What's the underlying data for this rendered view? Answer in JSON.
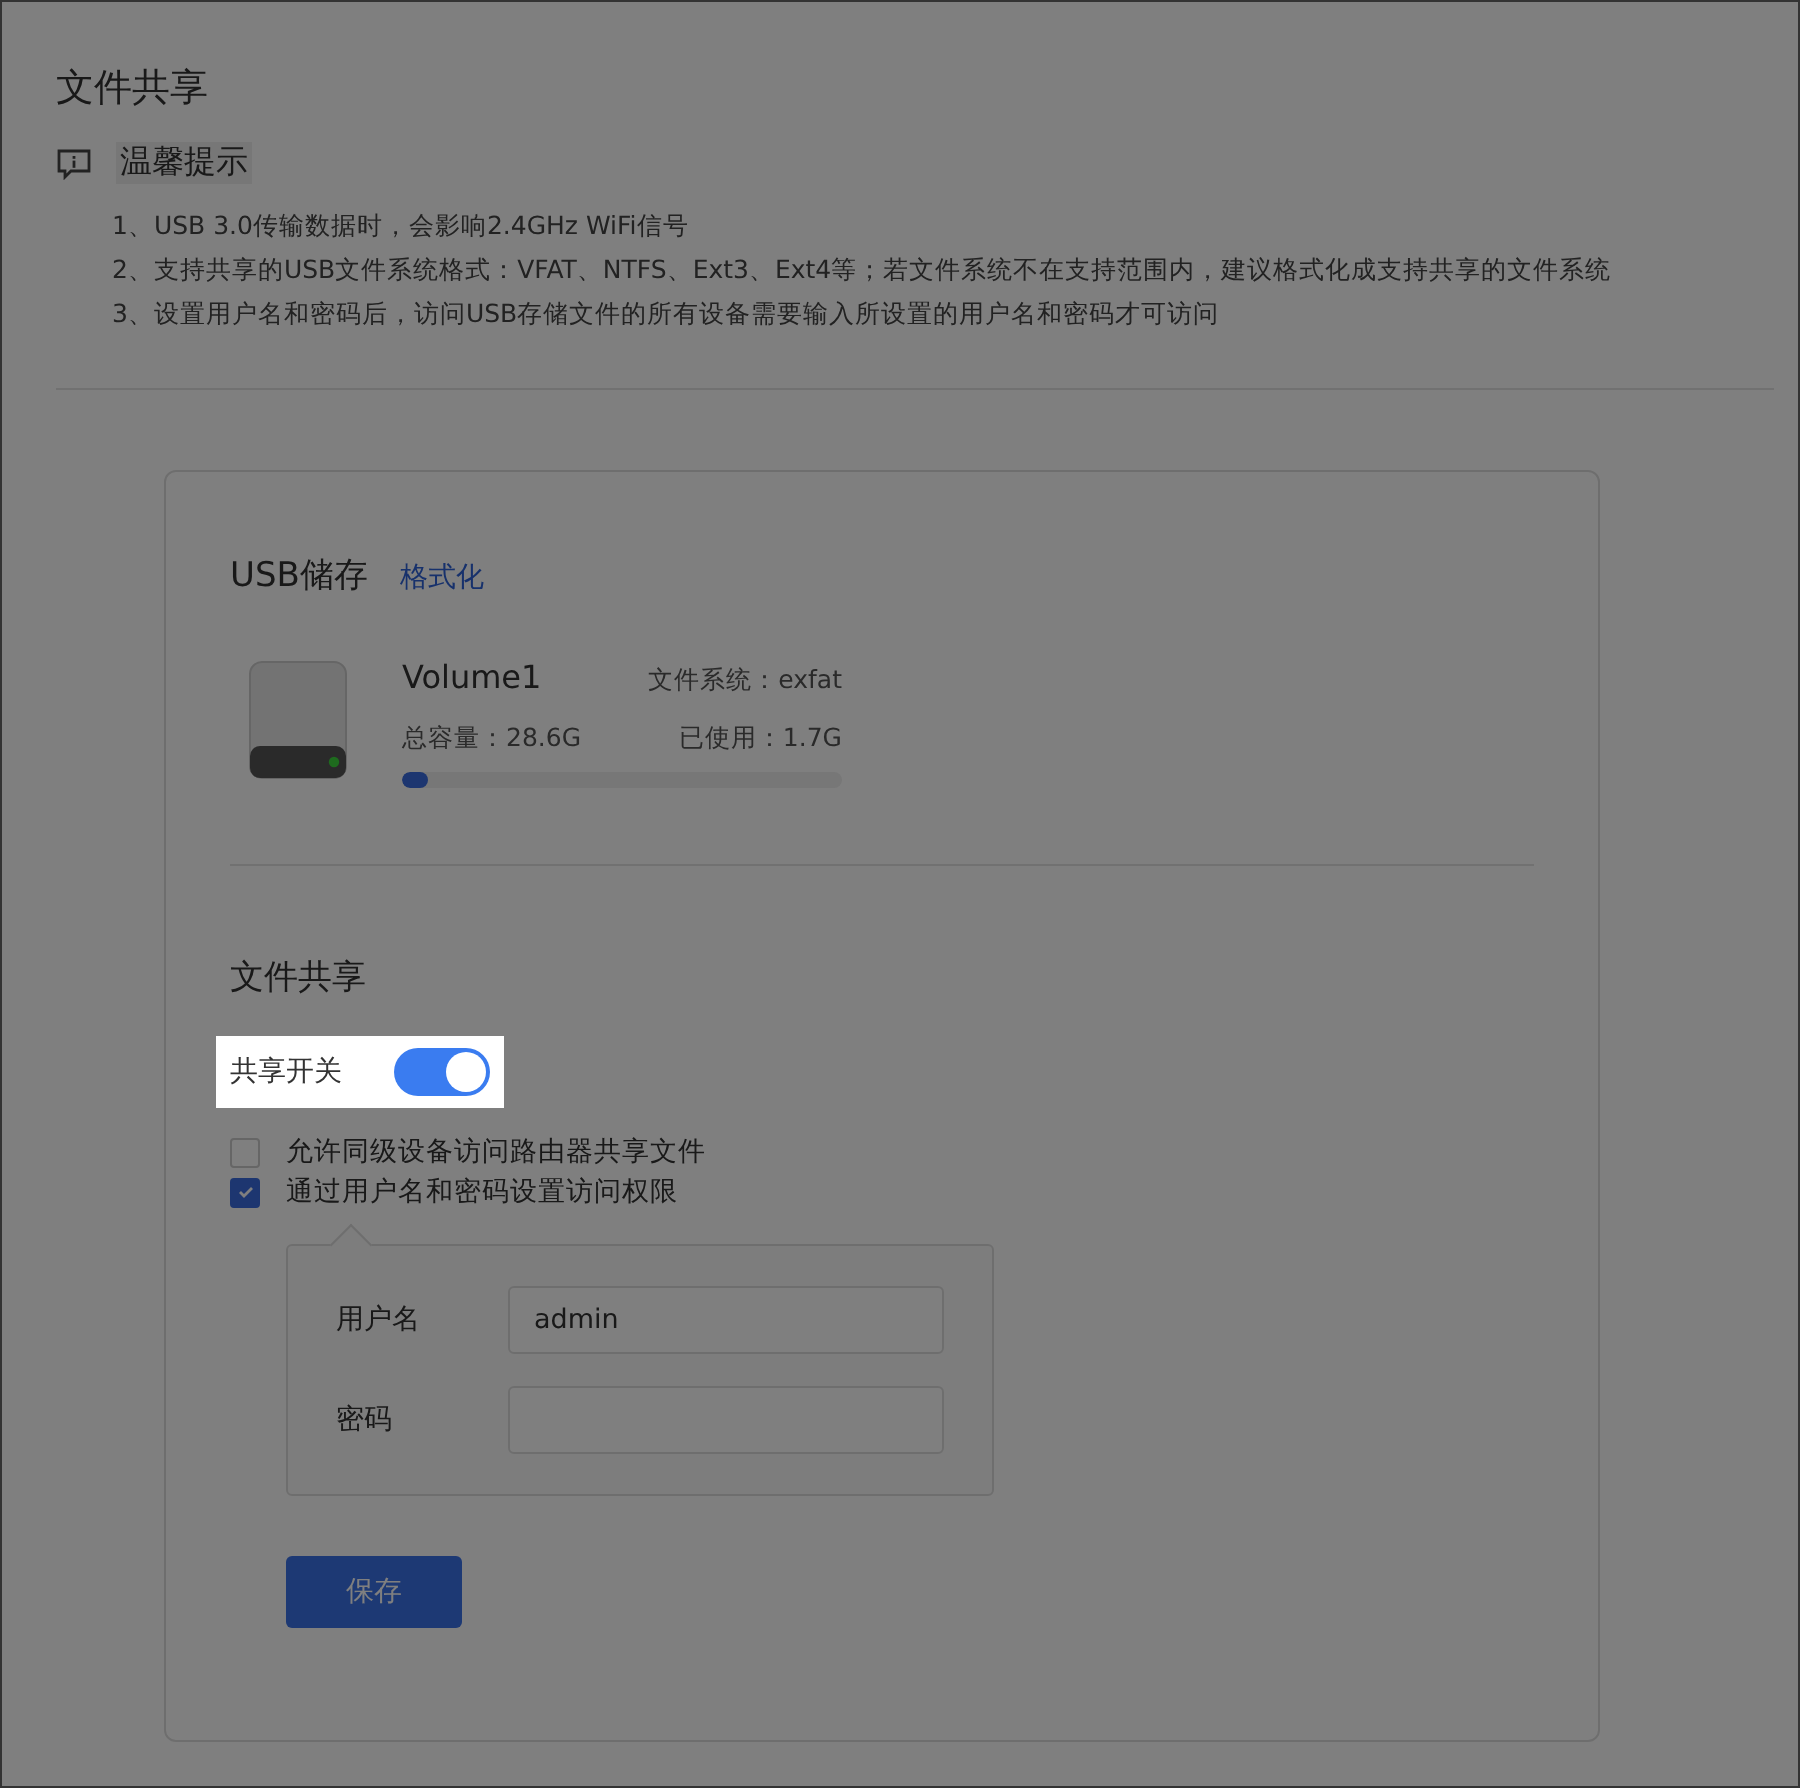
{
  "page": {
    "title": "文件共享"
  },
  "tips": {
    "title": "温馨提示",
    "items": [
      "1、USB 3.0传输数据时，会影响2.4GHz WiFi信号",
      "2、支持共享的USB文件系统格式：VFAT、NTFS、Ext3、Ext4等；若文件系统不在支持范围内，建议格式化成支持共享的文件系统",
      "3、设置用户名和密码后，访问USB存储文件的所有设备需要输入所设置的用户名和密码才可访问"
    ]
  },
  "usb": {
    "title": "USB储存",
    "format_link": "格式化",
    "volume": {
      "name": "Volume1",
      "filesystem": "文件系统：exfat",
      "capacity": "总容量：28.6G",
      "used": "已使用：1.7G",
      "level": 0.06
    }
  },
  "sharing": {
    "title": "文件共享",
    "switch": {
      "label": "共享开关",
      "on": true,
      "highlighted": true
    },
    "options": [
      {
        "label": "允许同级设备访问路由器共享文件",
        "checked": false
      },
      {
        "label": "通过用户名和密码设置访问权限",
        "checked": true
      }
    ],
    "credentials": {
      "fields": [
        {
          "label": "用户名",
          "kind": "text",
          "value": "admin"
        },
        {
          "label": "密码",
          "kind": "password"
        }
      ]
    },
    "save_button": "保存"
  }
}
